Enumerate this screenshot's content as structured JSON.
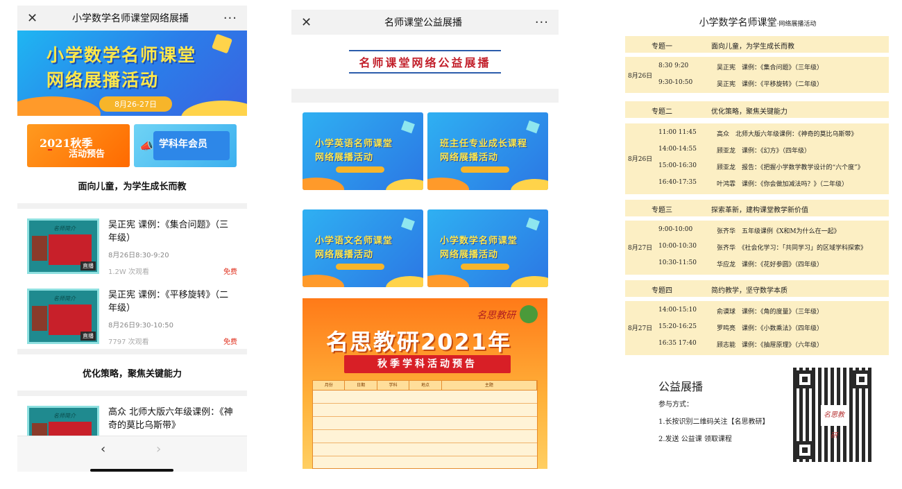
{
  "panel1": {
    "nav": {
      "close": "✕",
      "title": "小学数学名师课堂网络展播",
      "more": "···"
    },
    "hero": {
      "line1": "小学数学名师课堂",
      "line2": "网络展播活动",
      "date": "8月26-27日"
    },
    "banner_autumn": {
      "year": "2021秋季",
      "sub": "活动预告"
    },
    "banner_member": {
      "label": "学科年会员"
    },
    "section1_title": "面向儿童，为学生成长而教",
    "courses": [
      {
        "name": "吴正宪 课例：《集合问题》（三年级）",
        "time": "8月26日8:30-9:20",
        "views": "1.2W 次观看",
        "price": "免费",
        "thumb_title": "名师简介",
        "badge": "直播"
      },
      {
        "name": "吴正宪 课例：《平移旋转》（二年级）",
        "time": "8月26日9:30-10:50",
        "views": "7797 次观看",
        "price": "免费",
        "thumb_title": "名师简介",
        "badge": "直播"
      }
    ],
    "section2_title": "优化策略，聚焦关键能力",
    "course3": {
      "name": "高众 北师大版六年级课例：《神奇的莫比乌斯带》",
      "thumb_title": "名师简介"
    },
    "bottom": {
      "back": "‹",
      "forward": "›"
    }
  },
  "panel2": {
    "nav": {
      "close": "✕",
      "title": "名师课堂公益展播",
      "more": "···"
    },
    "banner": "名师课堂网络公益展播",
    "tiles": [
      {
        "line1": "小学英语名师课堂",
        "line2": "网络展播活动"
      },
      {
        "line1": "班主任专业成长课程",
        "line2": "网络展播活动"
      },
      {
        "line1": "小学语文名师课堂",
        "line2": "网络展播活动"
      },
      {
        "line1": "小学数学名师课堂",
        "line2": "网络展播活动"
      }
    ],
    "poster": {
      "logo": "名思教研",
      "title": "名思教研2021年",
      "ribbon": "秋季学科活动预告",
      "table_header": [
        "月份",
        "日期",
        "学科",
        "地点",
        "主题"
      ]
    }
  },
  "panel3": {
    "title": "小学数学名师课堂",
    "title_small": "·网络展播活动",
    "themes": [
      {
        "label": "专题一",
        "text": "面向儿童，为学生成长而教"
      },
      {
        "label": "专题二",
        "text": "优化策略，聚焦关键能力"
      },
      {
        "label": "专题三",
        "text": "探索革新，建构课堂教学新价值"
      },
      {
        "label": "专题四",
        "text": "简约教学，坚守数学本质"
      }
    ],
    "blocks": [
      {
        "date": "8月26日",
        "rows": [
          {
            "time": "8:30 9:20",
            "text": "吴正宪　课例：《集合问题》（三年级）"
          },
          {
            "time": "9:30-10:50",
            "text": "吴正宪　课例：《平移旋转》（二年级）"
          }
        ]
      },
      {
        "date": "8月26日",
        "rows": [
          {
            "time": "11:00 11:45",
            "text": "高众　北师大版六年级课例：《神奇的莫比乌斯带》"
          },
          {
            "time": "14:00-14:55",
            "text": "顾亚龙　课例：《幻方》（四年级）"
          },
          {
            "time": "15:00-16:30",
            "text": "顾亚龙　报告：《把握小学数学教学设计的“六个度”》"
          },
          {
            "time": "16:40-17:35",
            "text": "叶鸿霏　课例：《你会做加减法吗？》（二年级）"
          }
        ]
      },
      {
        "date": "8月27日",
        "rows": [
          {
            "time": "9:00-10:00",
            "text": "张齐华　五年级课例《X和M为什么在一起》"
          },
          {
            "time": "10:00-10:30",
            "text": "张齐华　《社会化学习：「共同学习」的区域学科探索》"
          },
          {
            "time": "10:30-11:50",
            "text": "华应龙　课例：《花好参圆》（四年级）"
          }
        ]
      },
      {
        "date": "8月27日",
        "rows": [
          {
            "time": "14:00-15:10",
            "text": "俞谟球　课例：《角的度量》（三年级）"
          },
          {
            "time": "15:20-16:25",
            "text": "罗鸣亮　课例：《小数乘法》（四年级）"
          },
          {
            "time": "16:35 17:40",
            "text": "顾志能　课例：《抽屉原理》（六年级）"
          }
        ]
      }
    ],
    "charity": {
      "heading": "公益展播",
      "method": "参与方式：",
      "step1": "1.长按识别二维码关注【名思教研】",
      "step2": "2.发送 公益课 领取课程",
      "qr_label": "名思教研"
    }
  }
}
